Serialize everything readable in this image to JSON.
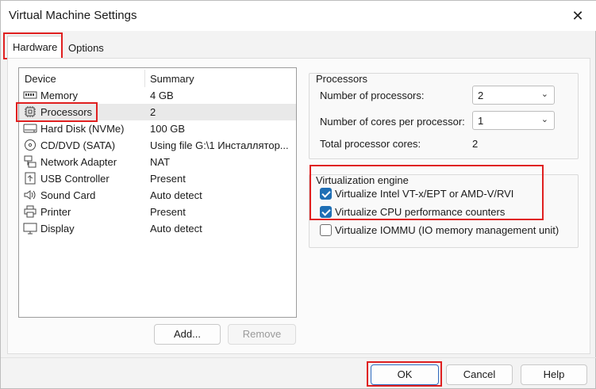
{
  "window": {
    "title": "Virtual Machine Settings",
    "close_glyph": "✕"
  },
  "tabs": [
    {
      "label": "Hardware",
      "active": true
    },
    {
      "label": "Options",
      "active": false
    }
  ],
  "device_list": {
    "columns": [
      "Device",
      "Summary"
    ],
    "rows": [
      {
        "icon": "memory-icon",
        "name": "Memory",
        "summary": "4 GB"
      },
      {
        "icon": "processor-icon",
        "name": "Processors",
        "summary": "2",
        "selected": true
      },
      {
        "icon": "hard-disk-icon",
        "name": "Hard Disk (NVMe)",
        "summary": "100 GB"
      },
      {
        "icon": "cd-dvd-icon",
        "name": "CD/DVD (SATA)",
        "summary": "Using file G:\\1 Инсталлятор..."
      },
      {
        "icon": "network-adapter-icon",
        "name": "Network Adapter",
        "summary": "NAT"
      },
      {
        "icon": "usb-icon",
        "name": "USB Controller",
        "summary": "Present"
      },
      {
        "icon": "sound-card-icon",
        "name": "Sound Card",
        "summary": "Auto detect"
      },
      {
        "icon": "printer-icon",
        "name": "Printer",
        "summary": "Present"
      },
      {
        "icon": "display-icon",
        "name": "Display",
        "summary": "Auto detect"
      }
    ],
    "add_label": "Add...",
    "remove_label": "Remove"
  },
  "processors": {
    "title": "Processors",
    "num_processors_label": "Number of processors:",
    "num_processors_value": "2",
    "cores_label": "Number of cores per processor:",
    "cores_value": "1",
    "total_label": "Total processor cores:",
    "total_value": "2"
  },
  "virtualization": {
    "title": "Virtualization engine",
    "options": [
      {
        "label": "Virtualize Intel VT-x/EPT or AMD-V/RVI",
        "checked": true
      },
      {
        "label": "Virtualize CPU performance counters",
        "checked": true
      },
      {
        "label": "Virtualize IOMMU (IO memory management unit)",
        "checked": false
      }
    ]
  },
  "footer": {
    "ok_label": "OK",
    "cancel_label": "Cancel",
    "help_label": "Help"
  },
  "colors": {
    "highlight": "#e02020",
    "accent": "#1f6fb5"
  }
}
